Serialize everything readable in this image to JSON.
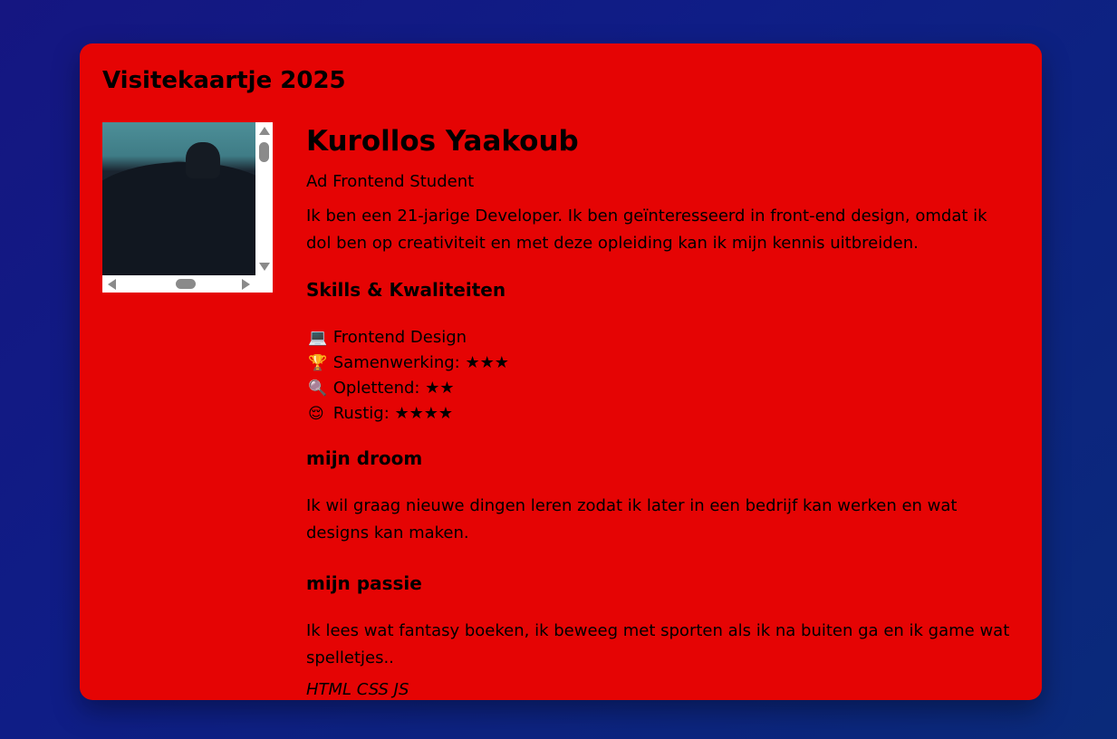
{
  "card": {
    "title": "Visitekaartje 2025"
  },
  "profile": {
    "name": "Kurollos Yaakoub",
    "role": "Ad Frontend Student",
    "bio": "Ik ben een 21-jarige Developer. Ik ben geïnteresseerd in front-end design, omdat ik dol ben op creativiteit en met deze opleiding kan ik mijn kennis uitbreiden."
  },
  "skills": {
    "heading": "Skills & Kwaliteiten",
    "items": [
      {
        "icon": "laptop-icon",
        "emoji": "💻",
        "label": "Frontend Design"
      },
      {
        "icon": "trophy-icon",
        "emoji": "🏆",
        "label": "Samenwerking: ★★★"
      },
      {
        "icon": "magnifier-icon",
        "emoji": "🔍",
        "label": "Oplettend: ★★"
      },
      {
        "icon": "relieved-face-icon",
        "emoji": "😌",
        "label": "Rustig: ★★★★"
      }
    ]
  },
  "dream": {
    "heading": "mijn droom",
    "text": "Ik wil graag nieuwe dingen leren zodat ik later in een bedrijf kan werken en wat designs kan maken."
  },
  "passion": {
    "heading": "mijn passie",
    "text": "Ik lees wat fantasy boeken, ik beweeg met sporten als ik na buiten ga en ik game wat spelletjes.."
  },
  "tech": "HTML CSS JS",
  "colors": {
    "card_background": "#e50404",
    "page_background": "#151681"
  }
}
